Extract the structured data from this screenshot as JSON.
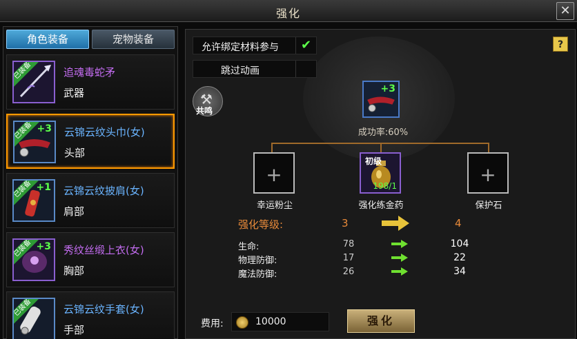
{
  "window": {
    "title": "强化",
    "close": "✕"
  },
  "tabs": [
    {
      "label": "角色装备"
    },
    {
      "label": "宠物装备"
    }
  ],
  "items": [
    {
      "tag": "已装备",
      "plus": "",
      "name": "追魂毒蛇矛",
      "slot": "武器",
      "name_color": "purple"
    },
    {
      "tag": "已装备",
      "plus": "+3",
      "name": "云锦云纹头巾(女)",
      "slot": "头部",
      "name_color": "blue"
    },
    {
      "tag": "已装备",
      "plus": "+1",
      "name": "云锦云纹披肩(女)",
      "slot": "肩部",
      "name_color": "blue"
    },
    {
      "tag": "已装备",
      "plus": "+3",
      "name": "秀纹丝缎上衣(女)",
      "slot": "胸部",
      "name_color": "purple"
    },
    {
      "tag": "已装备",
      "plus": "",
      "name": "云锦云纹手套(女)",
      "slot": "手部",
      "name_color": "blue"
    }
  ],
  "options": {
    "allow_bound": "允许绑定材料参与",
    "allow_bound_check": "✔",
    "skip_anim": "跳过动画"
  },
  "help": "?",
  "resonance": {
    "label": "共鸣"
  },
  "center": {
    "plus": "+3",
    "success": "成功率:60%"
  },
  "slots": {
    "left_label": "幸运粉尘",
    "mid_label": "强化练金药",
    "mid_grade": "初级",
    "mid_count": "198/1",
    "right_label": "保护石",
    "plus": "+"
  },
  "level": {
    "label": "强化等级:",
    "from": "3",
    "to": "4"
  },
  "stats": [
    {
      "label": "生命:",
      "from": "78",
      "to": "104"
    },
    {
      "label": "物理防御:",
      "from": "17",
      "to": "22"
    },
    {
      "label": "魔法防御:",
      "from": "26",
      "to": "34"
    }
  ],
  "cost": {
    "label": "费用:",
    "value": "10000"
  },
  "enhance_button": "强化",
  "colors": {
    "accent_orange": "#ff9a00",
    "equip_green": "#2e9b35",
    "plus_green": "#5cff4a"
  }
}
